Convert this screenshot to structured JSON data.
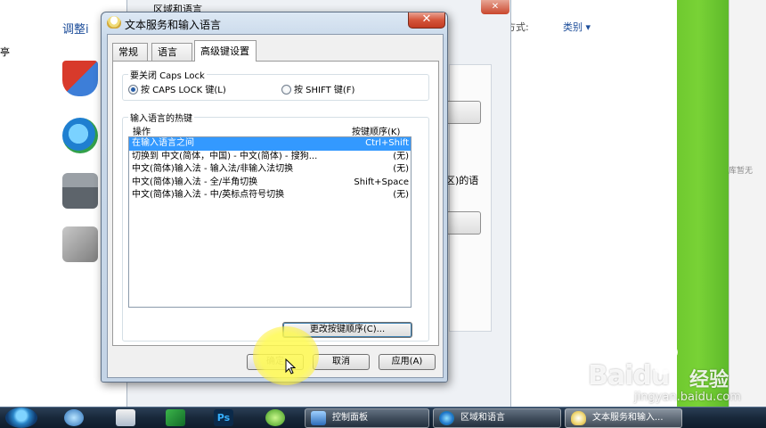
{
  "background": {
    "left_fragment": "亭",
    "right_fragment": "库暂无",
    "control_panel": {
      "heading_fragment": "调整i",
      "view_label": "方式:",
      "view_value": "类别 ▾"
    },
    "region_window": {
      "title": "区域和语言",
      "close_glyph": "✕",
      "side_text": "区)的语"
    }
  },
  "dialog": {
    "title": "文本服务和输入语言",
    "close_glyph": "✕",
    "tabs": [
      {
        "label": "常规",
        "active": false
      },
      {
        "label": "语言栏",
        "active": false
      },
      {
        "label": "高级键设置",
        "active": true
      }
    ],
    "caps_lock": {
      "group_title": "要关闭 Caps Lock",
      "options": [
        {
          "label": "按 CAPS LOCK 键(L)",
          "checked": true
        },
        {
          "label": "按 SHIFT 键(F)",
          "checked": false
        }
      ]
    },
    "hotkeys": {
      "group_title": "输入语言的热键",
      "col_action": "操作",
      "col_sequence": "按键顺序(K)",
      "rows": [
        {
          "action": "在输入语言之间",
          "keys": "Ctrl+Shift",
          "selected": true
        },
        {
          "action": "切换到 中文(简体，中国) - 中文(简体) - 搜狗...",
          "keys": "(无)",
          "selected": false
        },
        {
          "action": "中文(简体)输入法 - 输入法/非输入法切换",
          "keys": "(无)",
          "selected": false
        },
        {
          "action": "中文(简体)输入法 - 全/半角切换",
          "keys": "Shift+Space",
          "selected": false
        },
        {
          "action": "中文(简体)输入法 - 中/英标点符号切换",
          "keys": "(无)",
          "selected": false
        }
      ],
      "change_button": "更改按键顺序(C)..."
    },
    "buttons": {
      "ok": "确定",
      "cancel": "取消",
      "apply": "应用(A)"
    }
  },
  "taskbar": {
    "pins": {
      "photoshop": "Ps"
    },
    "tasks": [
      {
        "label": "控制面板"
      },
      {
        "label": "区域和语言"
      },
      {
        "label": "文本服务和输入..."
      }
    ]
  },
  "watermark": {
    "logo_text": "Baidu",
    "product": "经验",
    "url": "jingyan.baidu.com"
  },
  "colors": {
    "selection": "#3399ff",
    "accent": "#1e4e9a",
    "desktop_green": "#6fc92f"
  }
}
